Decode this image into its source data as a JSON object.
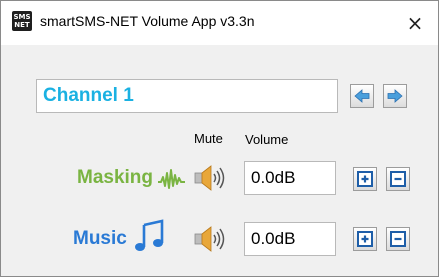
{
  "window": {
    "title": "smartSMS-NET Volume App v3.3n",
    "app_icon_text_top": "SMS",
    "app_icon_text_bottom": "NET",
    "close_glyph": "×"
  },
  "channel": {
    "value": "Channel 1",
    "prev_icon": "arrow-left-icon",
    "next_icon": "arrow-right-icon"
  },
  "headers": {
    "mute": "Mute",
    "volume": "Volume"
  },
  "rows": [
    {
      "label": "Masking",
      "label_color": "#7ab442",
      "icon": "waveform-icon",
      "mute_icon": "speaker-icon",
      "volume": "0.0dB"
    },
    {
      "label": "Music",
      "label_color": "#2a7ad5",
      "icon": "music-note-icon",
      "mute_icon": "speaker-icon",
      "volume": "0.0dB"
    }
  ],
  "buttons": {
    "increase_icon": "plus-icon",
    "decrease_icon": "minus-icon"
  },
  "colors": {
    "channel_text": "#1ab1e2",
    "button_icon": "#1e5ea8",
    "arrow_fill": "#4a9fdc"
  }
}
